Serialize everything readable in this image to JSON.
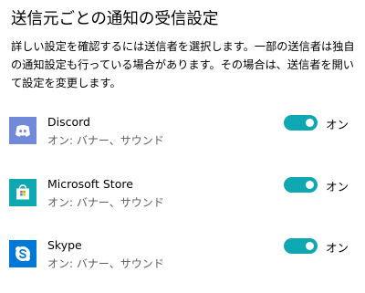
{
  "page": {
    "title": "送信元ごとの通知の受信設定",
    "description": "詳しい設定を確認するには送信者を選択します。一部の送信者は独自の通知設定も行っている場合があります。その場合は、送信者を開いて設定を変更します。"
  },
  "colors": {
    "toggle_on": "#0fa7b2",
    "discord_bg": "#7289da",
    "store_bg": "#0fa7b2",
    "skype_bg": "#0078d7"
  },
  "senders": [
    {
      "name": "Discord",
      "detail": "オン: バナー、サウンド",
      "toggle_state": "オン",
      "icon": "discord-icon"
    },
    {
      "name": "Microsoft Store",
      "detail": "オン: バナー、サウンド",
      "toggle_state": "オン",
      "icon": "microsoft-store-icon"
    },
    {
      "name": "Skype",
      "detail": "オン: バナー、サウンド",
      "toggle_state": "オン",
      "icon": "skype-icon"
    }
  ]
}
